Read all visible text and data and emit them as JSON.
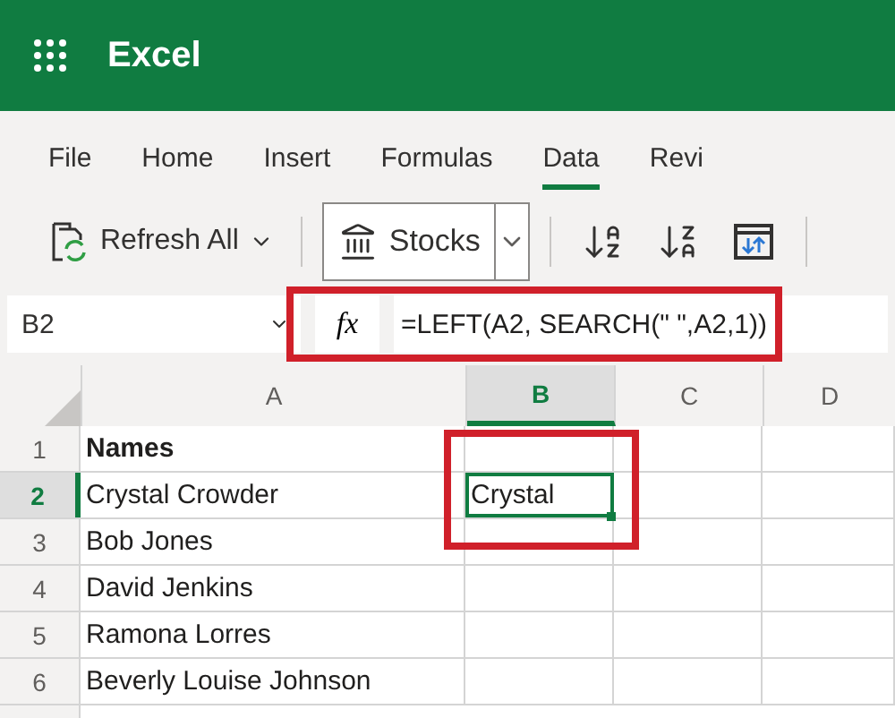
{
  "app": {
    "title": "Excel"
  },
  "tabs": [
    {
      "label": "File",
      "selected": false
    },
    {
      "label": "Home",
      "selected": false
    },
    {
      "label": "Insert",
      "selected": false
    },
    {
      "label": "Formulas",
      "selected": false
    },
    {
      "label": "Data",
      "selected": true
    },
    {
      "label": "Revi",
      "selected": false
    }
  ],
  "toolbar": {
    "refresh": {
      "label": "Refresh All"
    },
    "stocks": {
      "label": "Stocks"
    }
  },
  "formula_bar": {
    "name_box": "B2",
    "fx": "fx",
    "formula": "=LEFT(A2, SEARCH(\" \",A2,1))",
    "highlighted": true
  },
  "sheet": {
    "columns": [
      {
        "label": "A",
        "selected": false
      },
      {
        "label": "B",
        "selected": true
      },
      {
        "label": "C",
        "selected": false
      },
      {
        "label": "D",
        "selected": false
      }
    ],
    "rows": [
      {
        "number": "1",
        "selected": false,
        "cells": [
          {
            "text": "Names",
            "bold": true
          },
          {
            "text": ""
          },
          {
            "text": ""
          },
          {
            "text": ""
          }
        ]
      },
      {
        "number": "2",
        "selected": true,
        "cells": [
          {
            "text": "Crystal Crowder"
          },
          {
            "text": "Crystal",
            "active": true,
            "highlighted": true
          },
          {
            "text": ""
          },
          {
            "text": ""
          }
        ]
      },
      {
        "number": "3",
        "selected": false,
        "cells": [
          {
            "text": "Bob Jones"
          },
          {
            "text": ""
          },
          {
            "text": ""
          },
          {
            "text": ""
          }
        ]
      },
      {
        "number": "4",
        "selected": false,
        "cells": [
          {
            "text": "David Jenkins"
          },
          {
            "text": ""
          },
          {
            "text": ""
          },
          {
            "text": ""
          }
        ]
      },
      {
        "number": "5",
        "selected": false,
        "cells": [
          {
            "text": "Ramona Lorres"
          },
          {
            "text": ""
          },
          {
            "text": ""
          },
          {
            "text": ""
          }
        ]
      },
      {
        "number": "6",
        "selected": false,
        "cells": [
          {
            "text": "Beverly Louise Johnson"
          },
          {
            "text": ""
          },
          {
            "text": ""
          },
          {
            "text": ""
          }
        ]
      }
    ]
  }
}
